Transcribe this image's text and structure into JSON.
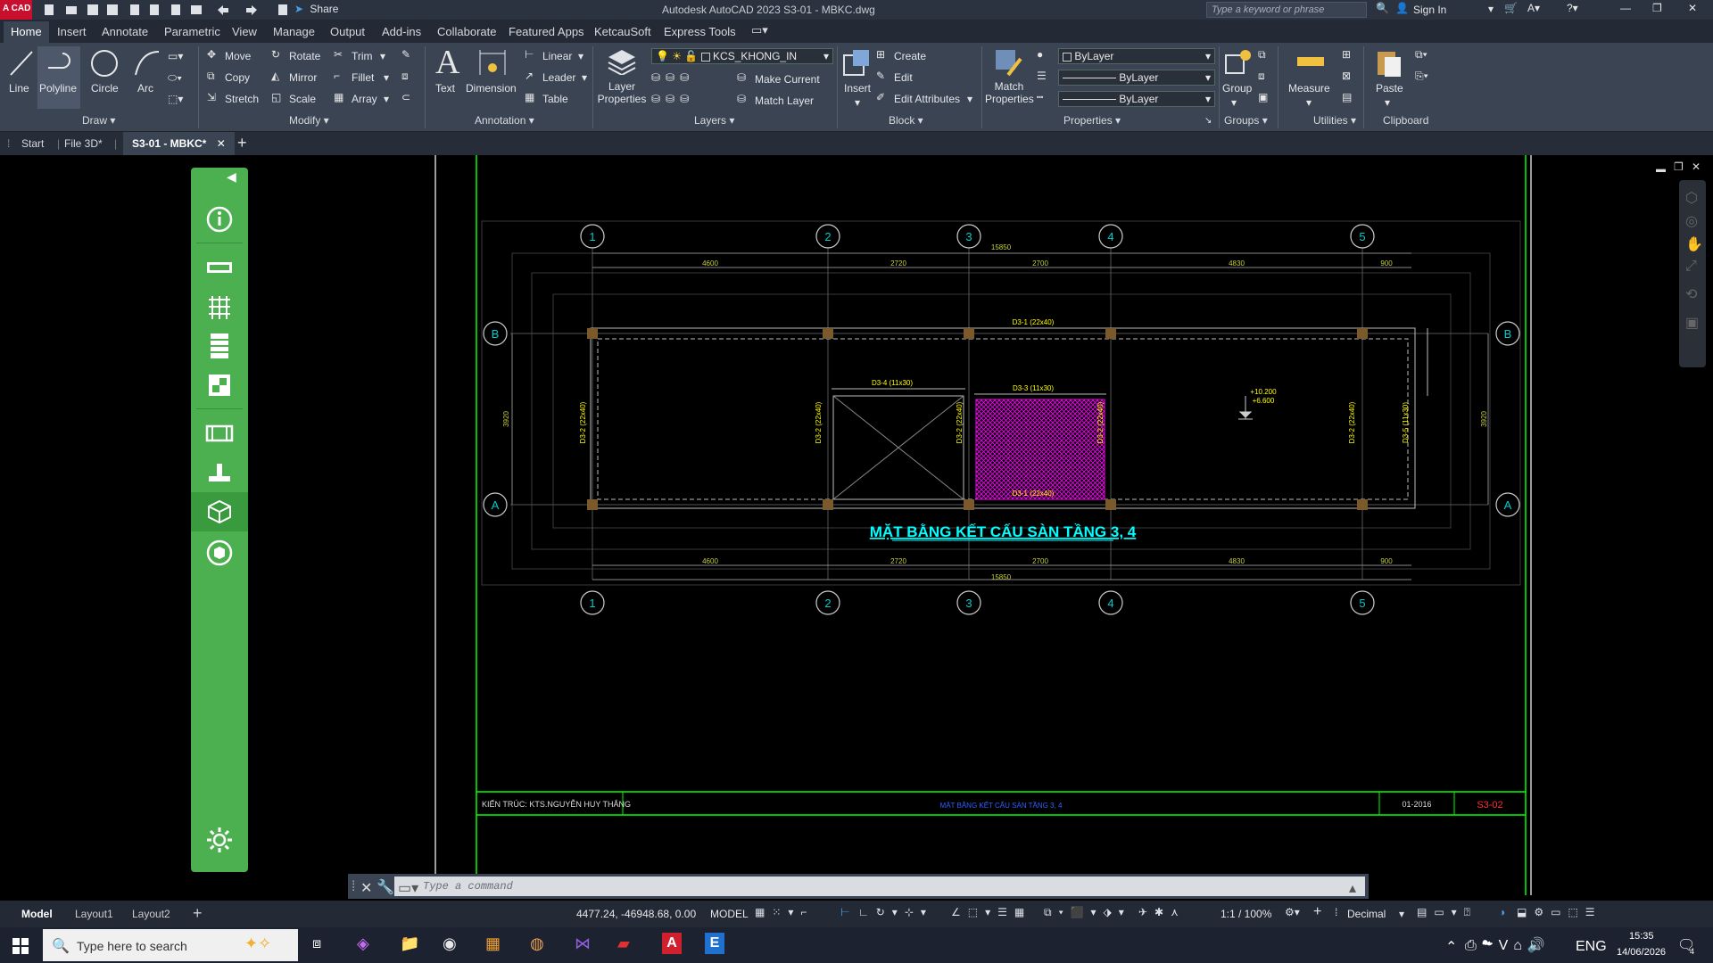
{
  "app": {
    "logo_text": "A CAD",
    "title": "Autodesk AutoCAD 2023   S3-01 - MBKC.dwg",
    "share_label": "Share",
    "search_placeholder": "Type a keyword or phrase",
    "sign_in": "Sign In"
  },
  "ribbon_tabs": [
    "Home",
    "Insert",
    "Annotate",
    "Parametric",
    "View",
    "Manage",
    "Output",
    "Add-ins",
    "Collaborate",
    "Featured Apps",
    "KetcauSoft",
    "Express Tools"
  ],
  "draw": {
    "line": "Line",
    "polyline": "Polyline",
    "circle": "Circle",
    "arc": "Arc",
    "panel": "Draw"
  },
  "modify": {
    "move": "Move",
    "rotate": "Rotate",
    "trim": "Trim",
    "copy": "Copy",
    "mirror": "Mirror",
    "fillet": "Fillet",
    "stretch": "Stretch",
    "scale": "Scale",
    "array": "Array",
    "panel": "Modify"
  },
  "annotation": {
    "text": "Text",
    "dimension": "Dimension",
    "linear": "Linear",
    "leader": "Leader",
    "table": "Table",
    "panel": "Annotation"
  },
  "layers": {
    "layer_properties": "Layer Properties",
    "current_layer": "KCS_KHONG_IN",
    "make_current": "Make Current",
    "match_layer": "Match Layer",
    "panel": "Layers"
  },
  "block": {
    "insert": "Insert",
    "create": "Create",
    "edit": "Edit",
    "edit_attributes": "Edit Attributes",
    "panel": "Block"
  },
  "properties": {
    "match_properties": "Match Properties",
    "color": "ByLayer",
    "linetype": "ByLayer",
    "lineweight": "ByLayer",
    "panel": "Properties"
  },
  "groups": {
    "group": "Group",
    "panel": "Groups"
  },
  "utilities": {
    "measure": "Measure",
    "panel": "Utilities"
  },
  "clipboard": {
    "paste": "Paste",
    "panel": "Clipboard"
  },
  "doc_tabs": [
    "Start",
    "File 3D*",
    "S3-01 - MBKC*"
  ],
  "drawing": {
    "title": "MẶT BẰNG KẾT CẤU SÀN TẦNG 3, 4",
    "grid_cols": [
      "1",
      "2",
      "3",
      "4",
      "5"
    ],
    "grid_rows": [
      "B",
      "A"
    ],
    "dims_top": [
      "4600",
      "2720",
      "2700",
      "4830",
      "900"
    ],
    "dims_bottom": [
      "4600",
      "2720",
      "2700",
      "4830",
      "900"
    ],
    "total_dim": "15850",
    "side_dim": "3920",
    "beams": {
      "d3_1_top": "D3-1 (22x40)",
      "d3_1_bottom": "D3-1 (22x40)",
      "d3_4": "D3-4 (11x30)",
      "d3_3": "D3-3 (11x30)",
      "d3_2_a": "D3-2 (22x40)",
      "d3_2_b": "D3-2 (22x40)",
      "d3_2_c": "D3-2 (22x40)",
      "d3_2_d": "D3-2 (22x40)",
      "d3_2_e": "D3-2 (22x40)",
      "d3_5": "D3-5 (11x30)"
    },
    "level_1": "+10.200",
    "level_2": "+6.600",
    "titleblock_left": "KIẾN TRÚC: KTS.NGUYỄN HUY THẮNG",
    "titleblock_mid": "MẶT BẰNG KẾT CẤU SÀN TẦNG 3, 4",
    "titleblock_date": "01-2016",
    "titleblock_sheet": "S3-02"
  },
  "command": {
    "placeholder": "Type a command"
  },
  "layout_tabs": [
    "Model",
    "Layout1",
    "Layout2"
  ],
  "status": {
    "coords": "4477.24, -46948.68, 0.00",
    "mode": "MODEL",
    "scale": "1:1 / 100%",
    "units": "Decimal"
  },
  "taskbar": {
    "search": "Type here to search",
    "lang": "ENG",
    "time": "15:35",
    "date": "14/06/2026",
    "notif": "4"
  },
  "colors": {
    "accent_green": "#4cb050",
    "titlebar": "#2b3340",
    "ribbon": "#3b4453",
    "dim_green": "#00ff00",
    "label_yellow": "#ffff00",
    "title_cyan": "#00ffff",
    "hatch_magenta": "#ff00ff"
  }
}
